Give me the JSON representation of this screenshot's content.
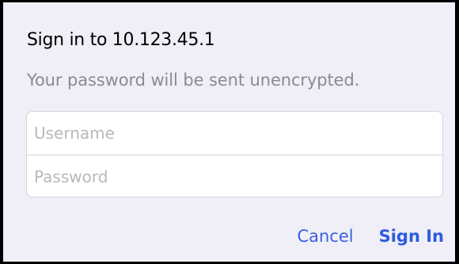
{
  "dialog": {
    "title": "Sign in to 10.123.45.1",
    "message": "Your password will be sent unencrypted.",
    "username": {
      "placeholder": "Username",
      "value": ""
    },
    "password": {
      "placeholder": "Password",
      "value": ""
    },
    "buttons": {
      "cancel_label": "Cancel",
      "sign_in_label": "Sign In"
    }
  },
  "colors": {
    "background": "#f0eef6",
    "accent": "#2c5be0",
    "secondary_text": "#8b8a92",
    "placeholder_text": "#b9b8bd",
    "frame": "#000000"
  }
}
